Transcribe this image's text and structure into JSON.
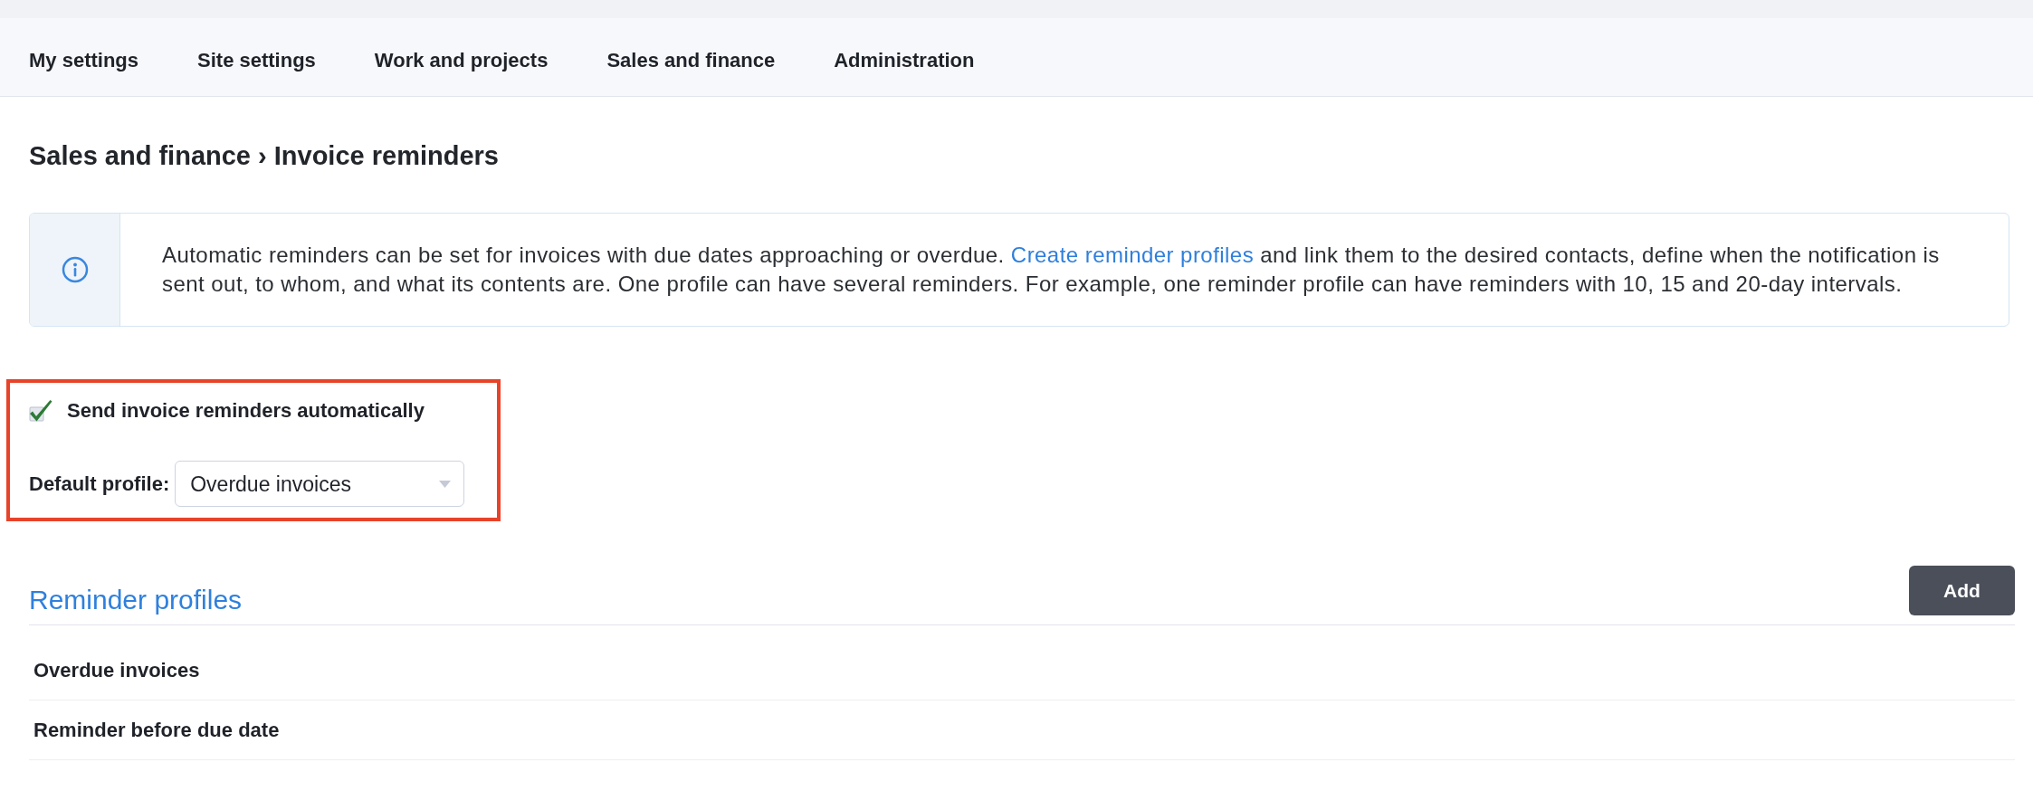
{
  "nav": {
    "items": [
      "My settings",
      "Site settings",
      "Work and projects",
      "Sales and finance",
      "Administration"
    ]
  },
  "page_title": "Sales and finance › Invoice reminders",
  "info": {
    "text_before": "Automatic reminders can be set for invoices with due dates approaching or overdue. ",
    "link": "Create reminder profiles",
    "text_after": " and link them to the desired contacts, define when the notification is sent out, to whom, and what its contents are. One profile can have several reminders. For example, one reminder profile can have reminders with 10, 15 and 20-day intervals."
  },
  "settings": {
    "highlighted": true,
    "auto_send": {
      "label": "Send invoice reminders automatically",
      "checked": true
    },
    "default_profile": {
      "label": "Default profile:",
      "value": "Overdue invoices"
    }
  },
  "reminder_profiles": {
    "title": "Reminder profiles",
    "add_button": "Add",
    "rows": [
      "Overdue invoices",
      "Reminder before due date"
    ]
  }
}
